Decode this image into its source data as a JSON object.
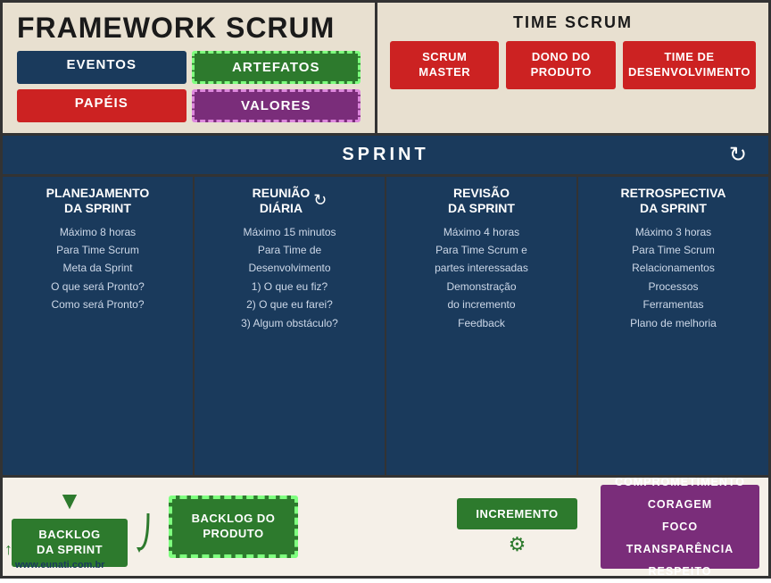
{
  "header": {
    "framework_title": "FRAMEWORK SCRUM",
    "eventos_label": "EVENTOS",
    "artefatos_label": "ARTEFATOS",
    "papeis_label": "PAPÉIS",
    "valores_label": "VALORES",
    "time_title": "TIME SCRUM",
    "scrum_master_label": "SCRUM\nMASTER",
    "dono_produto_label": "DONO DO\nPRODUTO",
    "time_dev_label": "TIME DE\nDESENVOLVIMENTO"
  },
  "sprint": {
    "label": "SPRINT"
  },
  "events": [
    {
      "title": "PLANEJAMENTO\nDA SPRINT",
      "content": "Máximo 8 horas\nPara Time Scrum\nMeta da Sprint\nO que será Pronto?\nComo será Pronto?",
      "has_refresh": false
    },
    {
      "title": "REUNIÃO\nDIÁRIA",
      "content": "Máximo 15 minutos\nPara Time de\nDesenvolvimento\n1) O que eu fiz?\n2) O que eu farei?\n3) Algum obstáculo?",
      "has_refresh": true
    },
    {
      "title": "REVISÃO\nDA SPRINT",
      "content": "Máximo 4 horas\nPara Time Scrum e\npartes interessadas\nDemonstração\ndo incremento\nFeedback",
      "has_refresh": false
    },
    {
      "title": "RETROSPECTIVA\nDA SPRINT",
      "content": "Máximo 3 horas\nPara Time Scrum\nRelacionamentos\nProcessos\nFerramentas\nPlano de melhoria",
      "has_refresh": false
    }
  ],
  "bottom": {
    "backlog_sprint_label": "BACKLOG\nDA SPRINT",
    "backlog_produto_label": "BACKLOG DO\nPRODUTO",
    "incremento_label": "INCREMENTO",
    "valores_list": "COMPROMETIMENTO\nCORAGEM\nFOCO\nTRANSPARÊNCIA\nRESPEITO"
  },
  "footer": {
    "website": "www.eunati.com.br"
  }
}
